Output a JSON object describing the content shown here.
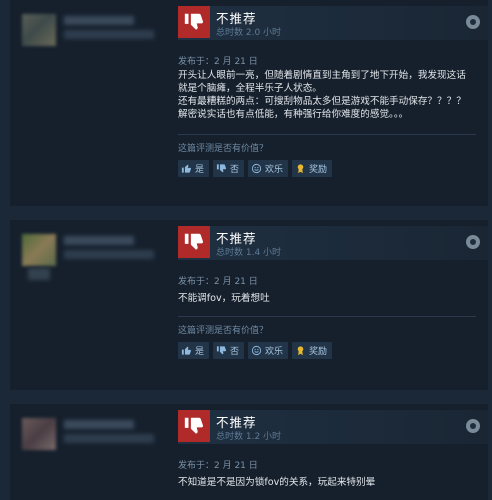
{
  "reviews": [
    {
      "verdict": "不推荐",
      "hours": "总时数 2.0 小时",
      "posted": "发布于：2 月 21 日",
      "lines": [
        "开头让人眼前一亮，但随着剧情直到主角到了地下开始，我发现这话",
        "就是个脑瘫，全程半乐子人状态。",
        "还有最糟糕的两点：可搜刮物品太多但是游戏不能手动保存？？？？",
        "解密说实话也有点低能，有种强行给你难度的感觉。。。"
      ],
      "helpful_q": "这篇评测是否有价值？",
      "buttons": [
        "是",
        "否",
        "欢乐",
        "奖励"
      ]
    },
    {
      "verdict": "不推荐",
      "hours": "总时数 1.4 小时",
      "posted": "发布于：2 月 21 日",
      "lines": [
        "不能调fov，玩着想吐"
      ],
      "helpful_q": "这篇评测是否有价值？",
      "buttons": [
        "是",
        "否",
        "欢乐",
        "奖励"
      ]
    },
    {
      "verdict": "不推荐",
      "hours": "总时数 1.2 小时",
      "posted": "发布于：2 月 21 日",
      "lines": [
        "不知道是不是因为锁fov的关系，玩起来特别晕"
      ]
    }
  ],
  "icons": {
    "thumb": "thumbs-down-icon",
    "yes": "thumbs-up-icon",
    "no": "thumbs-down-icon",
    "funny": "smiley-icon",
    "award": "award-icon",
    "steam": "steam-icon"
  },
  "colors": {
    "negative": "#b12a2a",
    "background": "#1b2838",
    "card": "#16202d",
    "button": "#223548"
  }
}
